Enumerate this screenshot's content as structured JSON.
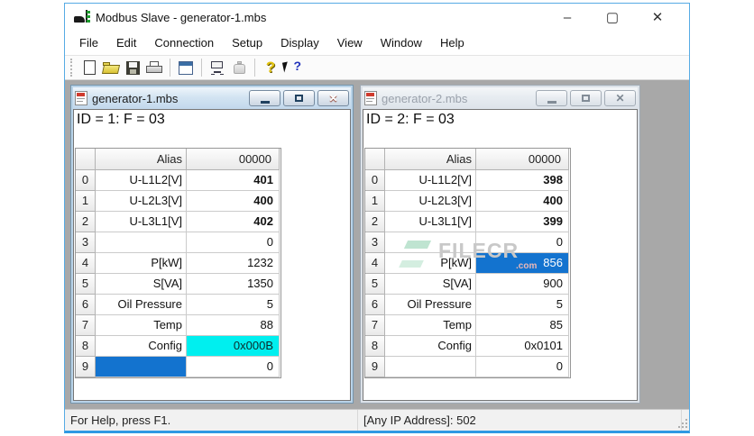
{
  "app": {
    "title": "Modbus Slave - generator-1.mbs",
    "menu": [
      "File",
      "Edit",
      "Connection",
      "Setup",
      "Display",
      "View",
      "Window",
      "Help"
    ],
    "window_controls": {
      "minimize": "–",
      "maximize": "▢",
      "close": "✕"
    },
    "status": {
      "help": "For Help, press F1.",
      "connection": "[Any IP Address]: 502"
    }
  },
  "icons": {
    "close_glyph": "✕",
    "help_glyph": "?",
    "context_help_glyph": "?"
  },
  "windows": [
    {
      "title": "generator-1.mbs",
      "active": true,
      "id_text": "ID = 1: F = 03",
      "columns": {
        "num": "",
        "alias": "Alias",
        "reg": "00000"
      },
      "rows": [
        {
          "n": "0",
          "alias": "U-L1L2[V]",
          "value": "401",
          "bold": true
        },
        {
          "n": "1",
          "alias": "U-L2L3[V]",
          "value": "400",
          "bold": true
        },
        {
          "n": "2",
          "alias": "U-L3L1[V]",
          "value": "402",
          "bold": true
        },
        {
          "n": "3",
          "alias": "",
          "value": "0"
        },
        {
          "n": "4",
          "alias": "P[kW]",
          "value": "1232"
        },
        {
          "n": "5",
          "alias": "S[VA]",
          "value": "1350"
        },
        {
          "n": "6",
          "alias": "Oil Pressure",
          "value": "5"
        },
        {
          "n": "7",
          "alias": "Temp",
          "value": "88"
        },
        {
          "n": "8",
          "alias": "Config",
          "value": "0x000B",
          "value_cyan": true
        },
        {
          "n": "9",
          "alias": "",
          "value": "0",
          "alias_sel": true
        }
      ]
    },
    {
      "title": "generator-2.mbs",
      "active": false,
      "id_text": "ID = 2: F = 03",
      "columns": {
        "num": "",
        "alias": "Alias",
        "reg": "00000"
      },
      "rows": [
        {
          "n": "0",
          "alias": "U-L1L2[V]",
          "value": "398",
          "bold": true
        },
        {
          "n": "1",
          "alias": "U-L2L3[V]",
          "value": "400",
          "bold": true
        },
        {
          "n": "2",
          "alias": "U-L3L1[V]",
          "value": "399",
          "bold": true
        },
        {
          "n": "3",
          "alias": "",
          "value": "0"
        },
        {
          "n": "4",
          "alias": "P[kW]",
          "value": "856",
          "value_sel": true
        },
        {
          "n": "5",
          "alias": "S[VA]",
          "value": "900"
        },
        {
          "n": "6",
          "alias": "Oil Pressure",
          "value": "5"
        },
        {
          "n": "7",
          "alias": "Temp",
          "value": "85"
        },
        {
          "n": "8",
          "alias": "Config",
          "value": "0x0101"
        },
        {
          "n": "9",
          "alias": "",
          "value": "0"
        }
      ]
    }
  ],
  "watermark": {
    "text": "FILECR",
    "suffix": ".com"
  },
  "colors": {
    "accent_border": "#2f99e3",
    "selection_blue": "#1373cf",
    "highlight_cyan": "#00efef",
    "mdi_background": "#a8a8a8"
  }
}
